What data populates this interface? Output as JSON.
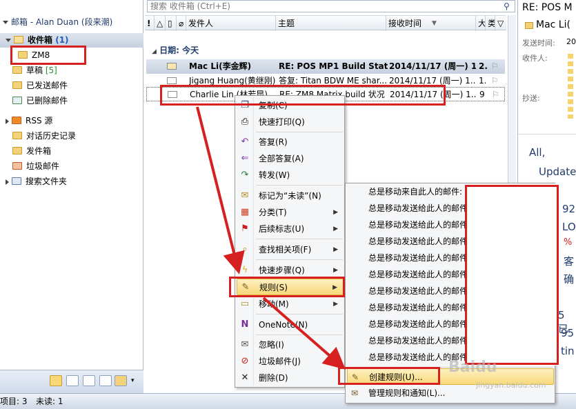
{
  "nav": {
    "account": "邮箱 - Alan Duan (段来潮)",
    "inbox": "收件箱",
    "inbox_count": "(1)",
    "zm8": "ZM8",
    "drafts": "草稿",
    "drafts_count": "[5]",
    "sent": "已发送邮件",
    "deleted": "已删除邮件",
    "rss": "RSS 源",
    "history": "对话历史记录",
    "outbox": "发件箱",
    "junk": "垃圾邮件",
    "search_folders": "搜索文件夹"
  },
  "search": {
    "placeholder": "搜索 收件箱 (Ctrl+E)"
  },
  "list": {
    "headers": {
      "from": "发件人",
      "subject": "主题",
      "received": "接收时间",
      "size": "大",
      "cat": "类",
      "flag": "▽"
    },
    "group": "日期: 今天",
    "rows": [
      {
        "from": "Mac Li(李金辉)",
        "subject": "RE: POS MP1 Build Stat...",
        "date": "2014/11/17 (周一) 1...",
        "size": "2..."
      },
      {
        "from": "Jigang Huang(黄继刚)",
        "subject": "答复: Titan BDW ME shar...",
        "date": "2014/11/17 (周一) 1...",
        "size": "1..."
      },
      {
        "from": "Charlie Lin (林若昆)",
        "subject": "RE: ZM8 Matrix build 状况",
        "date": "2014/11/17 (周一) 1...",
        "size": "9"
      }
    ]
  },
  "reading": {
    "title": "RE: POS M",
    "sender": "Mac Li(",
    "sent_label": "发送时间:",
    "sent_value": "20",
    "to_label": "收件人:",
    "cc_label": "抄送:",
    "body_all": "All,",
    "body_update": "Update",
    "frag1": "92",
    "frag2": "LO",
    "frag3": "%",
    "frag4": "客",
    "frag5": "确",
    "frag6": "5 已",
    "frag7": "95",
    "frag8": "tin"
  },
  "context_menu": {
    "copy": "复制(C)",
    "quick_print": "快速打印(Q)",
    "reply": "答复(R)",
    "reply_all": "全部答复(A)",
    "forward": "转发(W)",
    "mark_unread": "标记为“未读”(N)",
    "categorize": "分类(T)",
    "follow_up": "后续标志(U)",
    "find_related": "查找相关项(F)",
    "quick_steps": "快速步骤(Q)",
    "rules": "规则(S)",
    "move": "移动(M)",
    "onenote": "OneNote(N)",
    "ignore": "忽略(I)",
    "junk": "垃圾邮件(J)",
    "delete": "删除(D)"
  },
  "submenu": {
    "item_from": "总是移动来自此人的邮件:",
    "item_sent": "总是移动发送给此人的邮件",
    "create_rule": "创建规则(U)...",
    "manage_rules": "管理规则和通知(L)..."
  },
  "status": {
    "items": "项目: 3",
    "unread": "未读: 1"
  },
  "watermark": {
    "text": "Baidu",
    "site": "jingyan.baidu.com"
  },
  "colors": {
    "annotation": "#d62020",
    "highlight": "#f8d97a",
    "nav_selected": "#c6d0de"
  }
}
